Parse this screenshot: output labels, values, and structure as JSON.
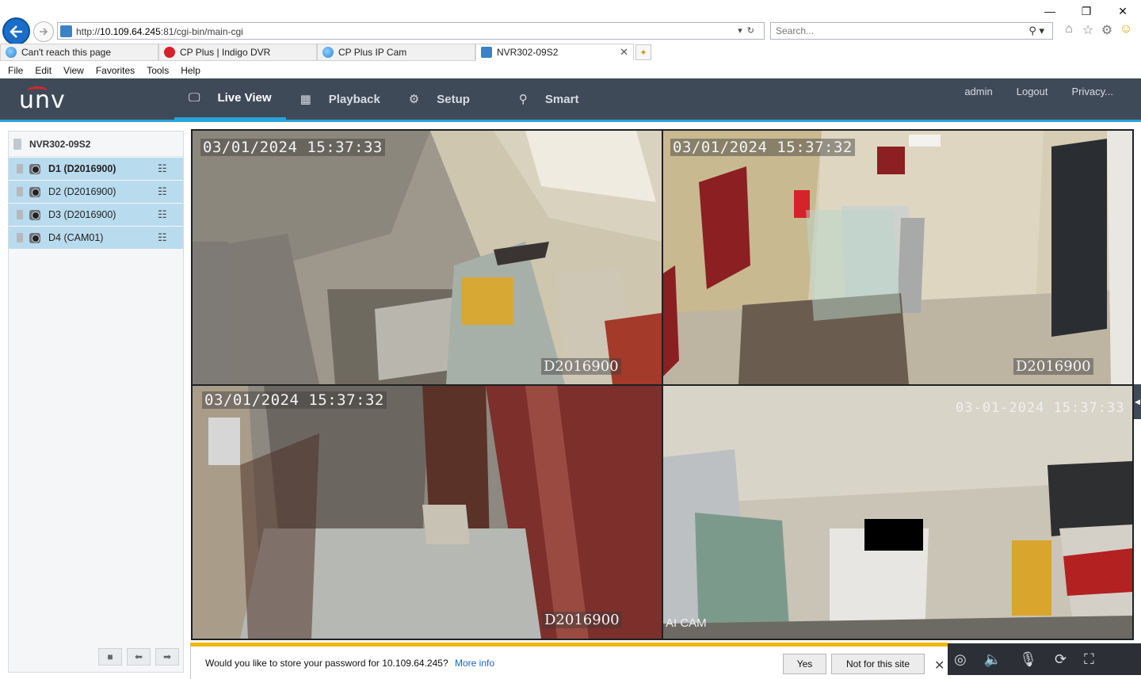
{
  "browser": {
    "url_prefix": "http://",
    "url_host": "10.109.64.245",
    "url_rest": ":81/cgi-bin/main-cgi",
    "search_placeholder": "Search...",
    "tabs": [
      {
        "label": "Can't reach this page",
        "icon": "ie-icon"
      },
      {
        "label": "CP Plus | Indigo DVR",
        "icon": "cpplus-icon"
      },
      {
        "label": "CP Plus IP Cam",
        "icon": "ie-icon"
      },
      {
        "label": "NVR302-09S2",
        "icon": "unv-icon"
      }
    ],
    "menu": [
      "File",
      "Edit",
      "View",
      "Favorites",
      "Tools",
      "Help"
    ]
  },
  "app": {
    "logo": "unv",
    "nav": [
      {
        "label": "Live View",
        "icon": "monitor-icon",
        "active": true
      },
      {
        "label": "Playback",
        "icon": "film-icon",
        "active": false
      },
      {
        "label": "Setup",
        "icon": "gear-icon",
        "active": false
      },
      {
        "label": "Smart",
        "icon": "person-icon",
        "active": false
      }
    ],
    "user_links": [
      "admin",
      "Logout",
      "Privacy..."
    ],
    "accent_color": "#2aa3d9",
    "header_color": "#3f4a58"
  },
  "devices": {
    "device_name": "NVR302-09S2",
    "channels": [
      {
        "label": "D1 (D2016900)",
        "selected": true
      },
      {
        "label": "D2 (D2016900)",
        "selected": false
      },
      {
        "label": "D3 (D2016900)",
        "selected": false
      },
      {
        "label": "D4 (CAM01)",
        "selected": false
      }
    ]
  },
  "video": {
    "tiles": [
      {
        "timestamp": "03/01/2024  15:37:33",
        "osd": "D2016900"
      },
      {
        "timestamp": "03/01/2024  15:37:32",
        "osd": "D2016900"
      },
      {
        "timestamp": "03/01/2024  15:37:32",
        "osd": "D2016900"
      },
      {
        "timestamp": "03-01-2024  15:37:33",
        "osd": "AI CAM"
      }
    ]
  },
  "notification": {
    "message": "Would you like to store your password for 10.109.64.245?",
    "more_info": "More info",
    "yes": "Yes",
    "not_for_site": "Not for this site"
  }
}
